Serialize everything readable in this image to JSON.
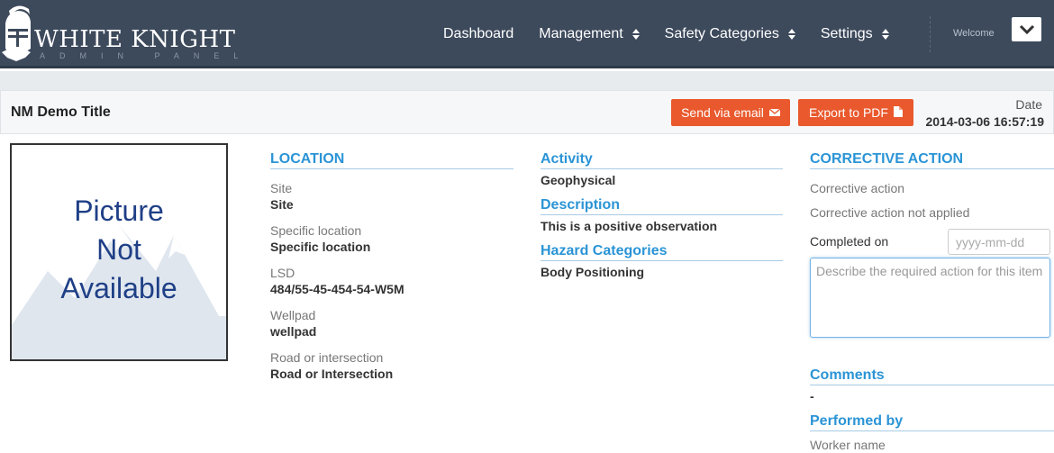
{
  "brand": {
    "title": "WHITE KNIGHT",
    "subtitle": "ADMIN PANEL",
    "logo_icon": "knight-helmet-icon"
  },
  "nav": {
    "items": [
      {
        "label": "Dashboard",
        "dropdown": false
      },
      {
        "label": "Management",
        "dropdown": true
      },
      {
        "label": "Safety Categories",
        "dropdown": true
      },
      {
        "label": "Settings",
        "dropdown": true
      }
    ],
    "welcome": "Welcome"
  },
  "header": {
    "title": "NM Demo Title",
    "email_button": "Send via email",
    "pdf_button": "Export to PDF",
    "date_label": "Date",
    "date_value": "2014-03-06 16:57:19"
  },
  "picture": {
    "line1": "Picture",
    "line2": "Not",
    "line3": "Available"
  },
  "location": {
    "heading": "LOCATION",
    "fields": [
      {
        "label": "Site",
        "value": "Site"
      },
      {
        "label": "Specific location",
        "value": "Specific location"
      },
      {
        "label": "LSD",
        "value": "484/55-45-454-54-W5M"
      },
      {
        "label": "Wellpad",
        "value": "wellpad"
      },
      {
        "label": "Road or intersection",
        "value": "Road or Intersection"
      }
    ]
  },
  "activity": {
    "heading": "Activity",
    "value": "Geophysical",
    "description_heading": "Description",
    "description_value": "This is a positive observation",
    "hazard_heading": "Hazard Categories",
    "hazard_value": "Body Positioning"
  },
  "corrective": {
    "heading": "CORRECTIVE ACTION",
    "line1": "Corrective action",
    "line2": "Corrective action not applied",
    "completed_label": "Completed on",
    "date_placeholder": "yyyy-mm-dd",
    "textarea_placeholder": "Describe the required action for this item"
  },
  "comments": {
    "heading": "Comments",
    "value": "-"
  },
  "performed": {
    "heading": "Performed by",
    "first_label": "Worker name"
  },
  "colors": {
    "navbar": "#3d4a5c",
    "accent_blue": "#2b94d6",
    "button_orange": "#e9592d",
    "picture_text": "#1f3f86"
  }
}
